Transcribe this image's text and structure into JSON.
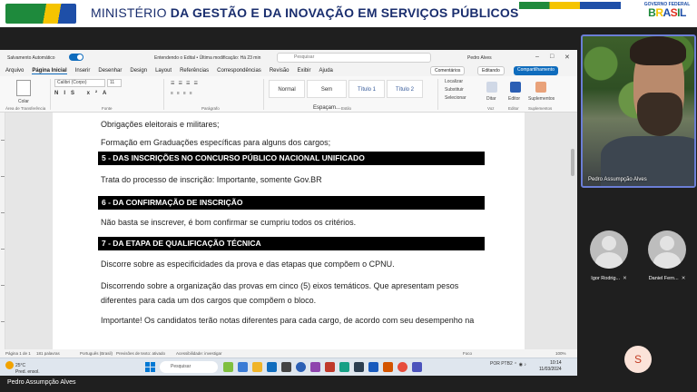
{
  "banner": {
    "title_regular": "MINISTÉRIO ",
    "title_bold": "DA GESTÃO E DA INOVAÇÃO EM SERVIÇOS PÚBLICOS",
    "gov_label": "GOVERNO FEDERAL",
    "gov_brand": [
      "B",
      "R",
      "A",
      "S",
      "I",
      "L"
    ]
  },
  "word": {
    "autosave_label": "Salvamento Automático",
    "doc_name": "Entendendo o Edital • Última modificação: Há 23 min",
    "search_placeholder": "Pesquisar",
    "user": "Pedro Alves",
    "menu": [
      "Arquivo",
      "Página Inicial",
      "Inserir",
      "Desenhar",
      "Design",
      "Layout",
      "Referências",
      "Correspondências",
      "Revisão",
      "Exibir",
      "Ajuda"
    ],
    "comments_label": "Comentários",
    "editing_label": "Editando",
    "share_label": "Compartilhamento",
    "ribbon": {
      "paste": "Colar",
      "font": "Calibri (Corpo)",
      "size": "11",
      "group_clipboard": "Área de Transferência",
      "group_font": "Fonte",
      "group_paragraph": "Parágrafo",
      "group_styles": "Estilo",
      "group_voice": "Voz",
      "group_editor": "Editor",
      "group_addins": "Suplementos",
      "styles": [
        "Normal",
        "Sem Espaçam...",
        "Título 1",
        "Título 2"
      ],
      "find": "Localizar",
      "replace": "Substituir",
      "select": "Selecionar",
      "dictate": "Ditar",
      "editor": "Editor",
      "addins": "Suplementos"
    },
    "content": {
      "line1": "Obrigações eleitorais e militares;",
      "line2": "Formação em Graduações específicas para alguns dos cargos;",
      "h5": "5 - DAS INSCRIÇÕES NO CONCURSO PÚBLICO NACIONAL UNIFICADO",
      "p5": "Trata do processo de inscrição: Importante, somente Gov.BR",
      "h6": "6 - DA CONFIRMAÇÃO DE INSCRIÇÃO",
      "p6": "Não basta se inscrever, é bom confirmar se cumpriu todos os critérios.",
      "h7": "7 - DA ETAPA DE QUALIFICAÇÃO TÉCNICA",
      "p7a": "Discorre sobre as especificidades da prova e das etapas que compõem o CPNU.",
      "p7b1": "Discorrendo sobre a organização das provas em cinco (5) eixos temáticos. Que apresentam pesos",
      "p7b2": "diferentes para cada um dos cargos que compõem o bloco.",
      "p7c": "Importante! Os candidatos terão notas diferentes para cada cargo, de acordo com seu desempenho na"
    },
    "status": {
      "page": "Página 1 de 1",
      "words": "181 palavras",
      "lang": "Português (Brasil)",
      "predict": "Previsões de texto: ativado",
      "access": "Acessibilidade: investigar",
      "focus": "Foco",
      "zoom": "100%"
    }
  },
  "taskbar": {
    "temp": "25°C",
    "weather": "Pred. ensol.",
    "search": "Pesquisar",
    "lang": "POR PTB2",
    "time": "10:14",
    "date": "11/03/2024"
  },
  "presenter_name": "Pedro Assumpção Alves",
  "video": {
    "speaker_name": "Pedro Assumpção Alves",
    "participants": [
      "Igor Rodrig...",
      "Daniel Fern..."
    ]
  },
  "badge": "S"
}
